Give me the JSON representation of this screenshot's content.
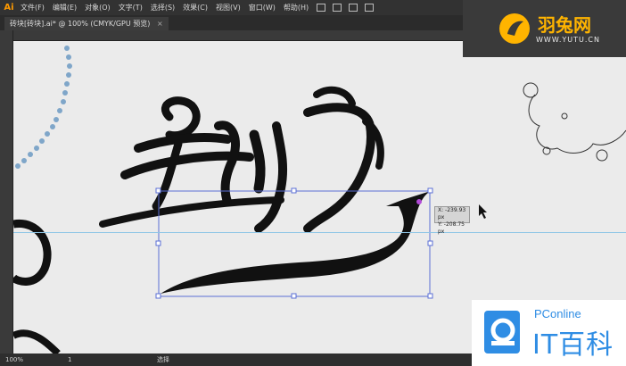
{
  "app": {
    "logo": "Ai"
  },
  "menu": [
    "文件(F)",
    "编辑(E)",
    "对象(O)",
    "文字(T)",
    "选择(S)",
    "效果(C)",
    "视图(V)",
    "窗口(W)",
    "帮助(H)"
  ],
  "tab": {
    "title": "砖块[砖块].ai* @ 100% (CMYK/GPU 预览)",
    "close": "×"
  },
  "tooltip": {
    "x": "X: -239.93 px",
    "y": "Y: -208.75 px"
  },
  "status": {
    "zoom": "100%",
    "page": "1",
    "tool": "选择"
  },
  "watermark_top": {
    "name": "羽兔网",
    "url": "WWW.YUTU.CN"
  },
  "watermark_bottom": {
    "brand": "PConline",
    "name": "IT百科"
  },
  "colors": {
    "accent": "#ff9a00",
    "selection": "#5b6fd6",
    "pconline": "#2f8de4",
    "guide": "#8fc6e6"
  }
}
